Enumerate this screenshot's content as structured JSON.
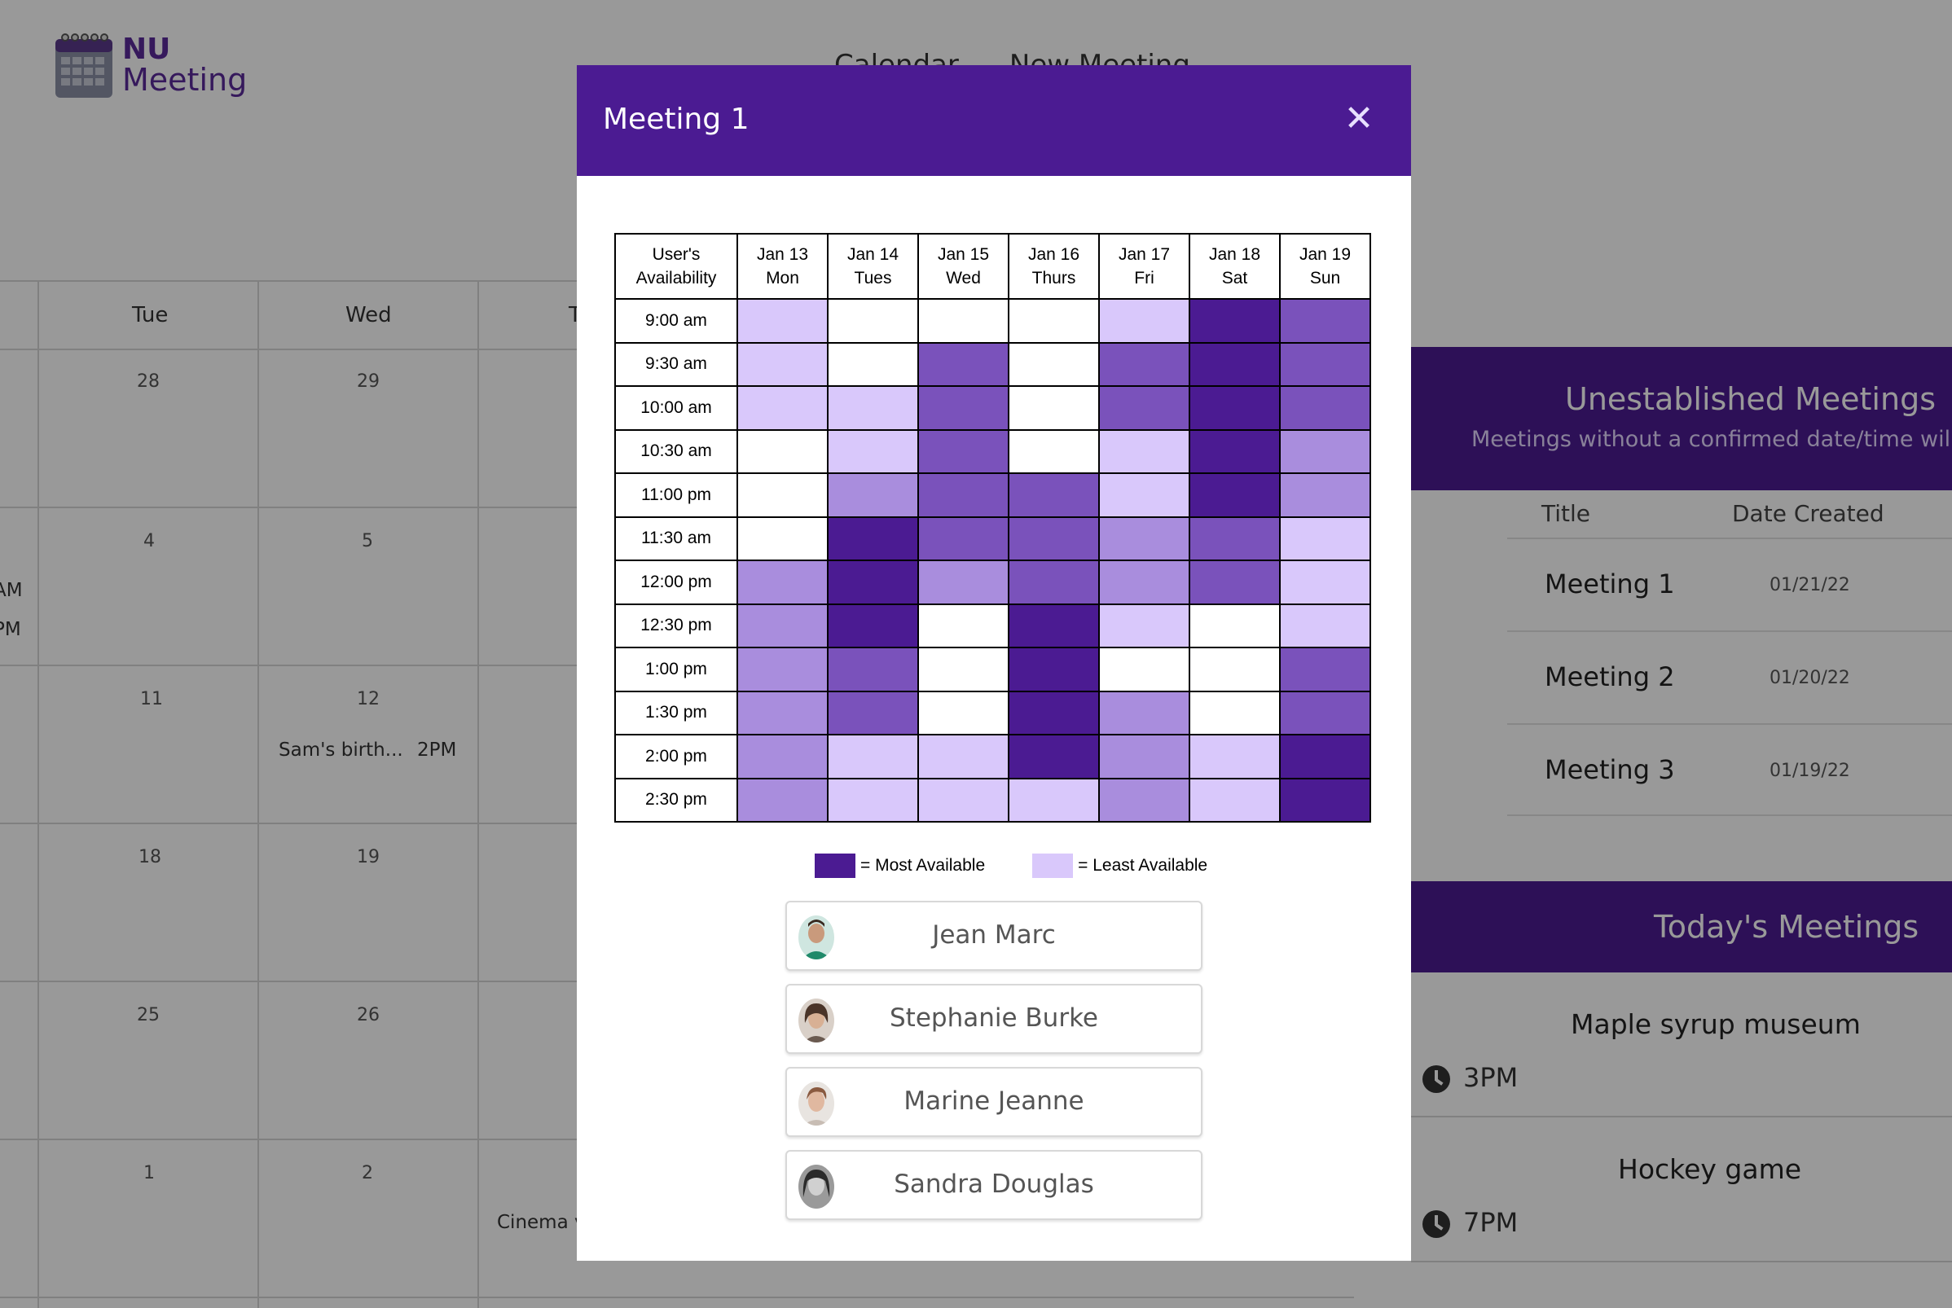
{
  "app": {
    "logo": {
      "line1": "NU",
      "line2": "Meeting"
    },
    "nav": [
      {
        "label": "Calendar"
      },
      {
        "label": "New Meeting"
      }
    ]
  },
  "calendar": {
    "days": [
      "Tue",
      "Wed",
      "T"
    ],
    "rows": [
      {
        "dates": [
          "28",
          "29"
        ]
      },
      {
        "dates": [
          "4",
          "5"
        ]
      },
      {
        "dates": [
          "11",
          "12"
        ]
      },
      {
        "dates": [
          "18",
          "19"
        ]
      },
      {
        "dates": [
          "25",
          "26"
        ]
      },
      {
        "dates": [
          "1",
          "2"
        ]
      }
    ],
    "events": [
      {
        "text": "AM"
      },
      {
        "text": "PM"
      },
      {
        "text": "Sam's birth..."
      },
      {
        "text": "2PM"
      },
      {
        "text": "Cinema v"
      }
    ]
  },
  "unestablished": {
    "title": "Unestablished Meetings",
    "subtitle": "Meetings without a confirmed date/time will a",
    "col_title": "Title",
    "col_date": "Date Created",
    "rows": [
      {
        "title": "Meeting 1",
        "date": "01/21/22"
      },
      {
        "title": "Meeting 2",
        "date": "01/20/22"
      },
      {
        "title": "Meeting 3",
        "date": "01/19/22"
      }
    ]
  },
  "today": {
    "title": "Today's Meetings",
    "items": [
      {
        "name": "Maple syrup museum",
        "time": "3PM"
      },
      {
        "name": "Hockey game",
        "time": "7PM"
      }
    ]
  },
  "modal": {
    "title": "Meeting 1",
    "close_icon": "close-icon",
    "corner_header": [
      "User's",
      "Availability"
    ],
    "days": [
      {
        "date": "Jan 13",
        "dow": "Mon"
      },
      {
        "date": "Jan 14",
        "dow": "Tues"
      },
      {
        "date": "Jan 15",
        "dow": "Wed"
      },
      {
        "date": "Jan 16",
        "dow": "Thurs"
      },
      {
        "date": "Jan 17",
        "dow": "Fri"
      },
      {
        "date": "Jan 18",
        "dow": "Sat"
      },
      {
        "date": "Jan 19",
        "dow": "Sun"
      }
    ],
    "times": [
      "9:00 am",
      "9:30 am",
      "10:00 am",
      "10:30 am",
      "11:00 pm",
      "11:30 am",
      "12:00 pm",
      "12:30 pm",
      "1:00 pm",
      "1:30 pm",
      "2:00 pm",
      "2:30 pm"
    ],
    "levels": {
      "0": "#ffffff",
      "1": "#d9c8fb",
      "2": "#a98ddd",
      "3": "#7a52bb",
      "4": "#4b1b92"
    },
    "availability": [
      [
        1,
        0,
        0,
        0,
        1,
        4,
        3
      ],
      [
        1,
        0,
        3,
        0,
        3,
        4,
        3
      ],
      [
        1,
        1,
        3,
        0,
        3,
        4,
        3
      ],
      [
        0,
        1,
        3,
        0,
        1,
        4,
        2
      ],
      [
        0,
        2,
        3,
        3,
        1,
        4,
        2
      ],
      [
        0,
        4,
        3,
        3,
        2,
        3,
        1
      ],
      [
        2,
        4,
        2,
        3,
        2,
        3,
        1
      ],
      [
        2,
        4,
        0,
        4,
        1,
        0,
        1
      ],
      [
        2,
        3,
        0,
        4,
        0,
        0,
        3
      ],
      [
        2,
        3,
        0,
        4,
        2,
        0,
        3
      ],
      [
        2,
        1,
        1,
        4,
        2,
        1,
        4
      ],
      [
        2,
        1,
        1,
        1,
        2,
        1,
        4
      ]
    ],
    "legend": {
      "most": "= Most Available",
      "least": "= Least Available",
      "most_color": "#4b1b92",
      "least_color": "#d9c8fb"
    },
    "participants": [
      {
        "name": "Jean Marc",
        "avatar": "avatar-photo"
      },
      {
        "name": "Stephanie Burke",
        "avatar": "avatar-photo"
      },
      {
        "name": "Marine Jeanne",
        "avatar": "avatar-photo"
      },
      {
        "name": "Sandra Douglas",
        "avatar": "avatar-photo"
      }
    ]
  }
}
